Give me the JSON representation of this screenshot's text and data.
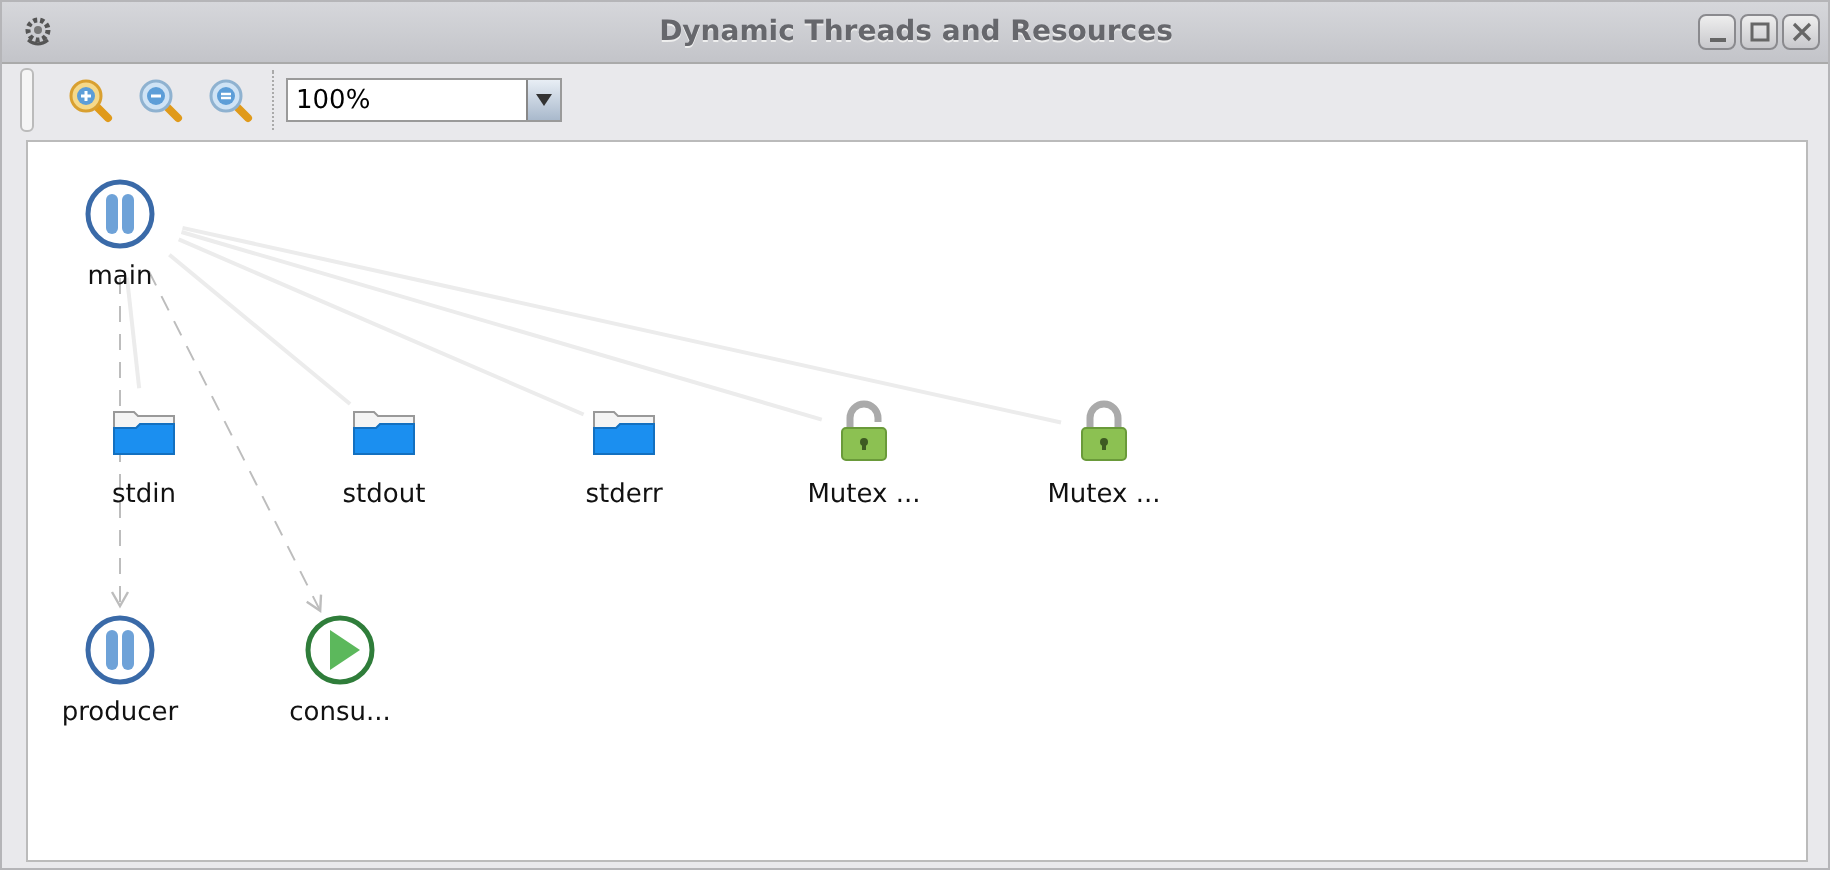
{
  "window": {
    "title": "Dynamic Threads and Resources"
  },
  "toolbar": {
    "zoom_value": "100%"
  },
  "nodes": [
    {
      "label": "main",
      "kind": "thread-paused"
    },
    {
      "label": "stdin",
      "kind": "file"
    },
    {
      "label": "stdout",
      "kind": "file"
    },
    {
      "label": "stderr",
      "kind": "file"
    },
    {
      "label": "Mutex ...",
      "kind": "lock-open"
    },
    {
      "label": "Mutex ...",
      "kind": "lock-closed"
    },
    {
      "label": "producer",
      "kind": "thread-paused"
    },
    {
      "label": "consu...",
      "kind": "thread-running"
    }
  ]
}
